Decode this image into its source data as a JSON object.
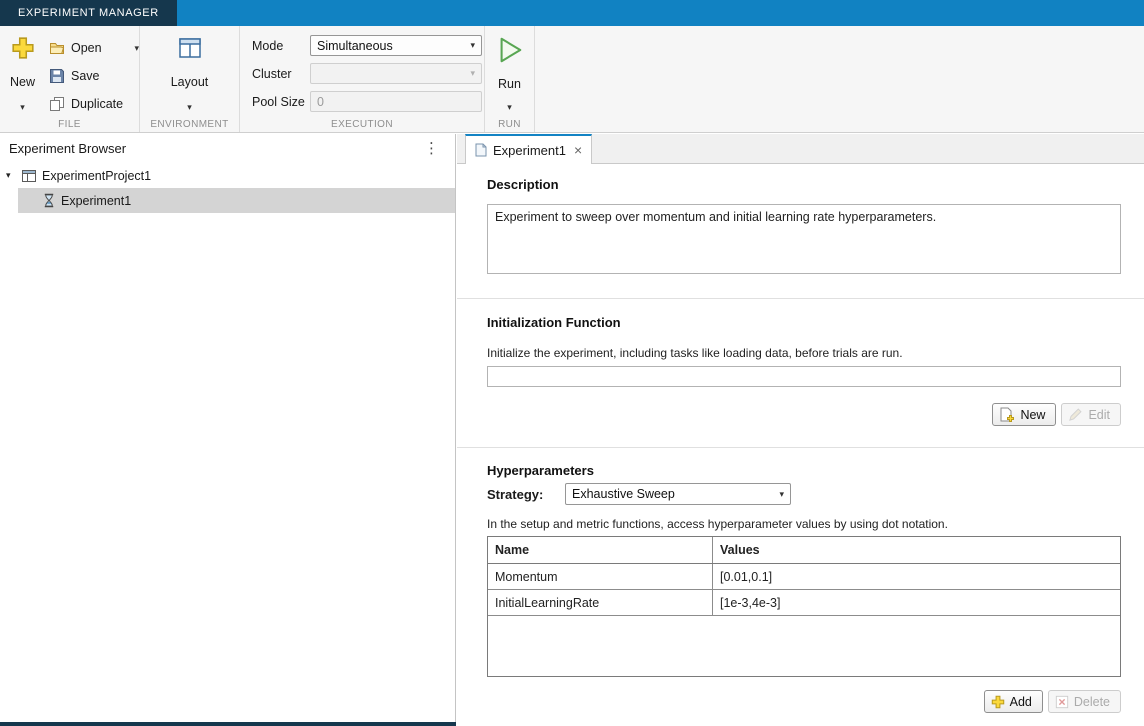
{
  "colors": {
    "titlebar_bg": "#1182c2",
    "titlebar_tab_bg": "#15374d",
    "accent_blue": "#1283c4",
    "selection_gray": "#d4d4d4",
    "run_green": "#58a652",
    "plus_yellow": "#fbd93c"
  },
  "icons": {
    "caret_down": "▾",
    "kebab": "⋮",
    "close": "×",
    "expand": "▾"
  },
  "titlebar": {
    "app_tab": "EXPERIMENT MANAGER"
  },
  "toolbar": {
    "file": {
      "section_label": "FILE",
      "new_label": "New",
      "open_label": "Open",
      "save_label": "Save",
      "duplicate_label": "Duplicate"
    },
    "environment": {
      "section_label": "ENVIRONMENT",
      "layout_label": "Layout"
    },
    "execution": {
      "section_label": "EXECUTION",
      "mode_label": "Mode",
      "mode_value": "Simultaneous",
      "cluster_label": "Cluster",
      "cluster_value": "",
      "pool_size_label": "Pool Size",
      "pool_size_value": "0"
    },
    "run": {
      "section_label": "RUN",
      "run_label": "Run"
    }
  },
  "browser": {
    "title": "Experiment Browser",
    "tree": [
      {
        "label": "ExperimentProject1"
      },
      {
        "label": "Experiment1"
      }
    ]
  },
  "doc": {
    "tab_label": "Experiment1",
    "description": {
      "heading": "Description",
      "text": "Experiment to sweep over momentum and initial learning rate hyperparameters."
    },
    "init": {
      "heading": "Initialization Function",
      "hint": "Initialize the experiment, including tasks like loading data, before trials are run.",
      "value": "",
      "new_label": "New",
      "edit_label": "Edit"
    },
    "hyper": {
      "heading": "Hyperparameters",
      "strategy_label": "Strategy:",
      "strategy_value": "Exhaustive Sweep",
      "hint": "In the setup and metric functions, access hyperparameter values by using dot notation.",
      "table": {
        "columns": [
          "Name",
          "Values"
        ],
        "rows": [
          [
            "Momentum",
            "[0.01,0.1]"
          ],
          [
            "InitialLearningRate",
            "[1e-3,4e-3]"
          ]
        ]
      },
      "add_label": "Add",
      "delete_label": "Delete"
    }
  }
}
